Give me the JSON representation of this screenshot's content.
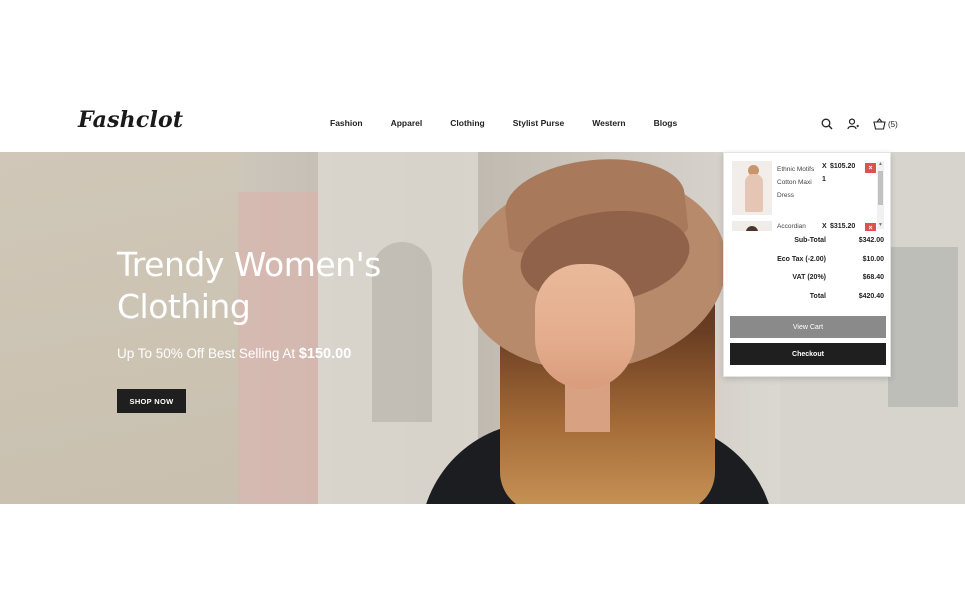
{
  "header": {
    "logo": "Fashclot",
    "nav": [
      "Fashion",
      "Apparel",
      "Clothing",
      "Stylist Purse",
      "Western",
      "Blogs"
    ],
    "cart_count": "(5)",
    "icons": [
      "search-icon",
      "user-icon",
      "cart-icon"
    ]
  },
  "hero": {
    "title": "Trendy Women's Clothing",
    "subtitle_prefix": "Up To 50% Off Best Selling At ",
    "subtitle_price": "$150.00",
    "cta": "SHOP NOW"
  },
  "cart": {
    "items": [
      {
        "name": "Ethnic Motifs Cotton Maxi Dress",
        "qty": "X",
        "qty_value": "1",
        "price": "$105.20",
        "remove": "×"
      },
      {
        "name": "Accordian",
        "qty": "X",
        "price": "$315.20",
        "remove": "×"
      }
    ],
    "totals": [
      {
        "label": "Sub-Total",
        "value": "$342.00"
      },
      {
        "label": "Eco Tax (-2.00)",
        "value": "$10.00"
      },
      {
        "label": "VAT (20%)",
        "value": "$68.40"
      },
      {
        "label": "Total",
        "value": "$420.40"
      }
    ],
    "view_cart": "View Cart",
    "checkout": "Checkout"
  },
  "colors": {
    "dark": "#1f1f1f",
    "remove_red": "#d9534f",
    "view_cart_gray": "#8a8a8a"
  }
}
